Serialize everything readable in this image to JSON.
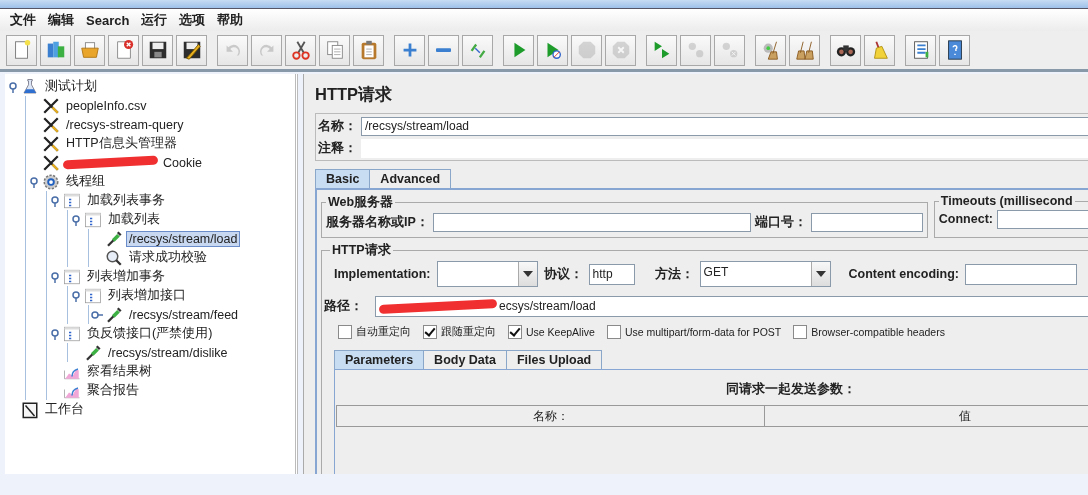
{
  "menu": [
    "文件",
    "编辑",
    "Search",
    "运行",
    "选项",
    "帮助"
  ],
  "toolbar": [
    [
      {
        "disabled": false
      },
      {
        "disabled": false
      },
      {
        "disabled": false
      },
      {
        "disabled": false
      },
      {
        "disabled": false
      },
      {
        "disabled": false
      }
    ],
    [
      {
        "disabled": true
      },
      {
        "disabled": true
      },
      {
        "disabled": false
      },
      {
        "disabled": false
      },
      {
        "disabled": false
      }
    ],
    [
      {
        "disabled": false
      },
      {
        "disabled": false
      },
      {
        "disabled": false
      }
    ],
    [
      {
        "disabled": false
      },
      {
        "disabled": false
      },
      {
        "disabled": true
      },
      {
        "disabled": true
      }
    ],
    [
      {
        "disabled": false
      },
      {
        "disabled": true
      },
      {
        "disabled": true
      }
    ],
    [
      {
        "disabled": false
      },
      {
        "disabled": false
      }
    ],
    [
      {
        "disabled": false
      },
      {
        "disabled": false
      }
    ],
    [
      {
        "disabled": false
      },
      {
        "disabled": false
      }
    ]
  ],
  "tree": [
    {
      "label": "测试计划",
      "kind": "plan",
      "expanded": true,
      "selected": false,
      "children": [
        {
          "label": "peopleInfo.csv",
          "kind": "config",
          "selected": false
        },
        {
          "label": "/recsys-stream-query",
          "kind": "config",
          "selected": false
        },
        {
          "label": "HTTP信息头管理器",
          "kind": "config",
          "selected": false
        },
        {
          "label": "Cookie",
          "kind": "config",
          "redacted": true,
          "selected": false
        },
        {
          "label": "线程组",
          "kind": "threadgroup",
          "expanded": true,
          "selected": false,
          "children": [
            {
              "label": "加载列表事务",
              "kind": "controller",
              "expanded": true,
              "selected": false,
              "children": [
                {
                  "label": "加载列表",
                  "kind": "controller",
                  "expanded": true,
                  "selected": false,
                  "children": [
                    {
                      "label": "/recsys/stream/load",
                      "kind": "sampler",
                      "selected": true
                    },
                    {
                      "label": "请求成功校验",
                      "kind": "assertion",
                      "selected": false
                    }
                  ]
                }
              ]
            },
            {
              "label": "列表增加事务",
              "kind": "controller",
              "expanded": true,
              "selected": false,
              "children": [
                {
                  "label": "列表增加接口",
                  "kind": "controller",
                  "expanded": true,
                  "selected": false,
                  "children": [
                    {
                      "label": "/recsys/stream/feed",
                      "kind": "sampler",
                      "expanded": false,
                      "selected": false
                    }
                  ]
                }
              ]
            },
            {
              "label": "负反馈接口(严禁使用)",
              "kind": "controller",
              "expanded": true,
              "selected": false,
              "children": [
                {
                  "label": "/recsys/stream/dislike",
                  "kind": "sampler",
                  "selected": false
                }
              ]
            },
            {
              "label": "察看结果树",
              "kind": "listener",
              "selected": false
            },
            {
              "label": "聚合报告",
              "kind": "listener",
              "selected": false
            }
          ]
        }
      ]
    },
    {
      "label": "工作台",
      "kind": "workbench",
      "selected": false
    }
  ],
  "editor": {
    "title": "HTTP请求",
    "name_label": "名称：",
    "name_value": "/recsys/stream/load",
    "comment_label": "注释：",
    "tabs": [
      {
        "label": "Basic",
        "selected": true
      },
      {
        "label": "Advanced",
        "selected": false
      }
    ],
    "web_server": {
      "legend": "Web服务器",
      "server_label": "服务器名称或IP：",
      "port_label": "端口号："
    },
    "timeouts": {
      "legend": "Timeouts (millisecond",
      "connect_label": "Connect:"
    },
    "http_request": {
      "legend": "HTTP请求",
      "implementation_label": "Implementation:",
      "protocol_label": "协议：",
      "protocol_value": "http",
      "method_label": "方法：",
      "method_value": "GET",
      "encoding_label": "Content encoding:",
      "path_label": "路径：",
      "path_value": "ecsys/stream/load",
      "path_redacted": true,
      "options": [
        {
          "label": "自动重定向",
          "checked": false
        },
        {
          "label": "跟随重定向",
          "checked": true
        },
        {
          "label": "Use KeepAlive",
          "checked": true
        },
        {
          "label": "Use multipart/form-data for POST",
          "checked": false
        },
        {
          "label": "Browser-compatible headers",
          "checked": false
        }
      ]
    },
    "param_tabs": [
      {
        "label": "Parameters",
        "selected": true
      },
      {
        "label": "Body Data",
        "selected": false
      },
      {
        "label": "Files Upload",
        "selected": false
      }
    ],
    "params": {
      "title": "同请求一起发送参数：",
      "columns": [
        "名称：",
        "值"
      ]
    }
  }
}
